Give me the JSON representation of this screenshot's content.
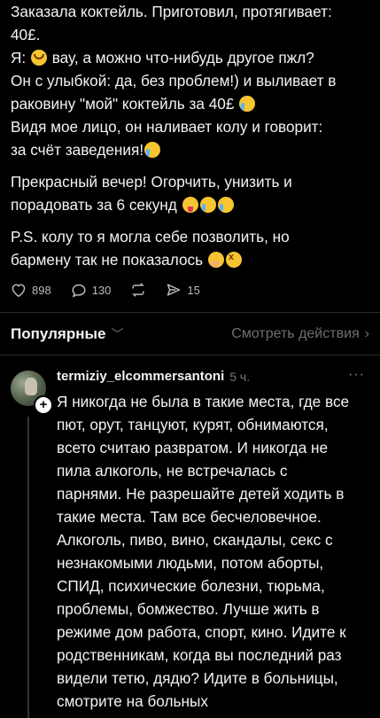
{
  "post": {
    "lines": [
      "Заказала коктейль. Приготовил, протягивает:",
      "40£.",
      "Я:",
      " вау, а можно что-нибудь другое пжл?",
      "Он с улыбкой: да, без проблем!) и выливает в",
      "раковину \"мой\" коктейль за 40£",
      "Видя мое лицо, он наливает колу и говорит:",
      "за счёт заведения!",
      "Прекрасный вечер! Огорчить, унизить и",
      "порадовать за 6 секунд",
      "P.S. колу то я могла себе позволить, но",
      "бармену так не показалось"
    ]
  },
  "actions": {
    "likes": "898",
    "comments": "130",
    "reposts_icon": "repost-icon",
    "shares": "15"
  },
  "sort": {
    "label": "Популярные",
    "view_activity": "Смотреть действия"
  },
  "comment": {
    "username": "termiziy_elcommersantoni",
    "time": "5 ч.",
    "more": "···",
    "lines": [
      "Я никогда не была в такие места, где все",
      "пют, орут, танцуют, курят, обнимаются,",
      "всето считаю развратом. И никогда не",
      "пила алкоголь, не встречалась с",
      "парнями. Не разрешайте детей ходить в",
      "такие места. Там все бесчеловечное.",
      "Алкоголь, пиво, вино, скандалы, секс с",
      "незнакомыми людьми, потом аборты,",
      "СПИД, психические болезни, тюрьма,",
      "проблемы, бомжество. Лучше жить в",
      "режиме дом работа, спорт, кино. Идите к",
      "родственникам, когда вы последний раз",
      "видели тетю, дядю? Идите в больницы,",
      "смотрите на больных"
    ]
  },
  "colors": {
    "background": "#000000",
    "text": "#f3f3f3",
    "muted": "#777777"
  }
}
